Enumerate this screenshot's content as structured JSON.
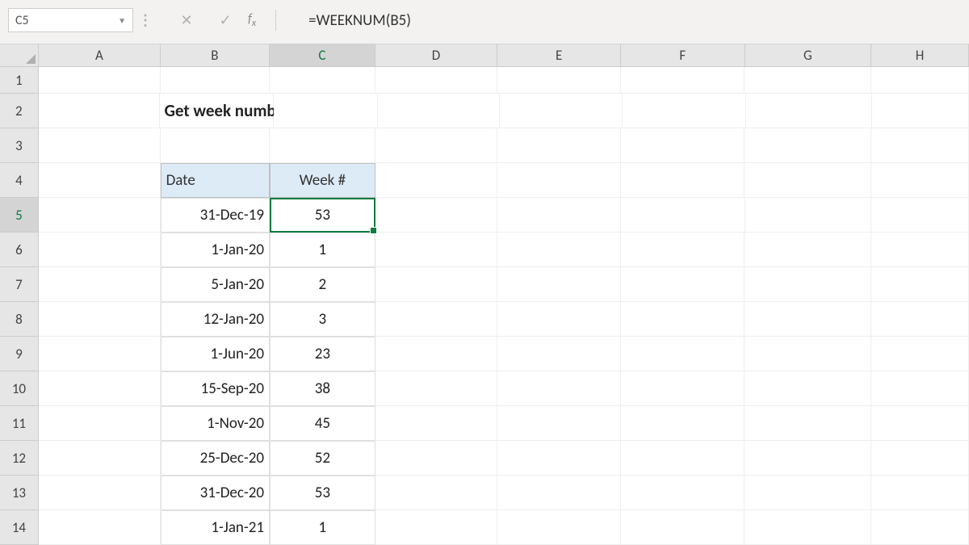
{
  "namebox": "C5",
  "formula": "=WEEKNUM(B5)",
  "columns": [
    "A",
    "B",
    "C",
    "D",
    "E",
    "F",
    "G",
    "H"
  ],
  "active_col": "C",
  "active_row": "5",
  "rows": [
    "1",
    "2",
    "3",
    "4",
    "5",
    "6",
    "7",
    "8",
    "9",
    "10",
    "11",
    "12",
    "13",
    "14"
  ],
  "title": "Get week number from date",
  "table": {
    "headers": {
      "date": "Date",
      "week": "Week #"
    },
    "rows": [
      {
        "date": "31-Dec-19",
        "week": "53"
      },
      {
        "date": "1-Jan-20",
        "week": "1"
      },
      {
        "date": "5-Jan-20",
        "week": "2"
      },
      {
        "date": "12-Jan-20",
        "week": "3"
      },
      {
        "date": "1-Jun-20",
        "week": "23"
      },
      {
        "date": "15-Sep-20",
        "week": "38"
      },
      {
        "date": "1-Nov-20",
        "week": "45"
      },
      {
        "date": "25-Dec-20",
        "week": "52"
      },
      {
        "date": "31-Dec-20",
        "week": "53"
      },
      {
        "date": "1-Jan-21",
        "week": "1"
      }
    ]
  }
}
